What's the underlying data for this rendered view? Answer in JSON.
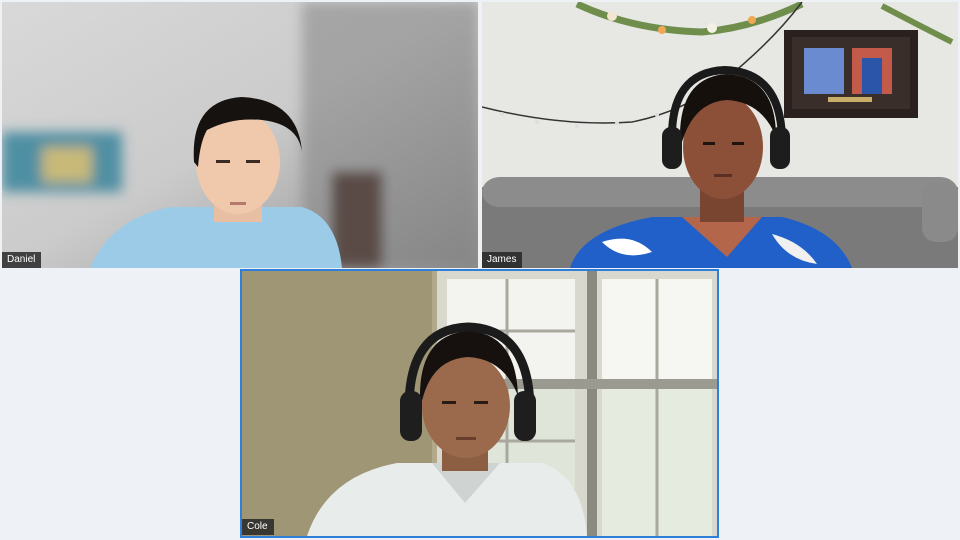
{
  "participants": [
    {
      "name": "Daniel",
      "active_speaker": false
    },
    {
      "name": "James",
      "active_speaker": false
    },
    {
      "name": "Cole",
      "active_speaker": true
    }
  ],
  "colors": {
    "active_speaker_border": "#2f7ed8",
    "background": "#eef1f5",
    "name_tag_bg": "#222222"
  }
}
